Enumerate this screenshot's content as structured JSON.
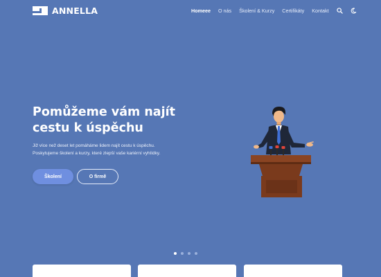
{
  "brand": {
    "name": "ANNELLA"
  },
  "nav": {
    "items": [
      {
        "label": "Homeee",
        "active": true
      },
      {
        "label": "O nás",
        "active": false
      },
      {
        "label": "Školení & Kurzy",
        "active": false
      },
      {
        "label": "Certifikáty",
        "active": false
      },
      {
        "label": "Kontakt",
        "active": false
      }
    ],
    "icons": [
      "search-icon",
      "moon-icon"
    ]
  },
  "hero": {
    "title_line1": "Pomůžeme vám najít",
    "title_line2": "cestu k úspěchu",
    "text_line1": "Již více než deset let pomáháme lidem najít cestu k úspěchu.",
    "text_line2": "Poskytujeme školení a kurzy, které zlepší vaše kariérní vyhlídky.",
    "primary_button": "Školení",
    "secondary_button": "O firmě"
  },
  "carousel": {
    "slides": 4,
    "active_index": 0
  },
  "colors": {
    "background": "#5677b5",
    "primary_button": "#6f8fe0",
    "podium": "#7a3a1c",
    "suit": "#1f2738",
    "tie": "#3f6fd6"
  }
}
